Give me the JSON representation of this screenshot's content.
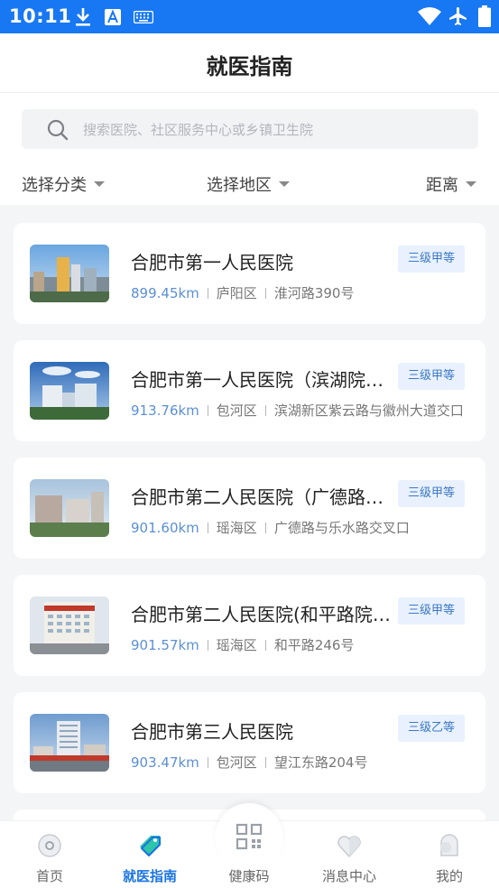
{
  "status_bar": {
    "time": "10:11"
  },
  "header": {
    "title": "就医指南"
  },
  "search": {
    "placeholder": "搜索医院、社区服务中心或乡镇卫生院"
  },
  "filters": {
    "category": "选择分类",
    "region": "选择地区",
    "distance": "距离"
  },
  "hospitals": [
    {
      "name": "合肥市第一人民医院",
      "level": "三级甲等",
      "distance": "899.45km",
      "district": "庐阳区",
      "address": "淮河路390号"
    },
    {
      "name": "合肥市第一人民医院（滨湖院区）",
      "level": "三级甲等",
      "distance": "913.76km",
      "district": "包河区",
      "address": "滨湖新区紫云路与徽州大道交口"
    },
    {
      "name": "合肥市第二人民医院（广德路院区）",
      "level": "三级甲等",
      "distance": "901.60km",
      "district": "瑶海区",
      "address": "广德路与乐水路交叉口"
    },
    {
      "name": "合肥市第二人民医院(和平路院区)",
      "level": "三级甲等",
      "distance": "901.57km",
      "district": "瑶海区",
      "address": "和平路246号"
    },
    {
      "name": "合肥市第三人民医院",
      "level": "三级乙等",
      "distance": "903.47km",
      "district": "包河区",
      "address": "望江东路204号"
    }
  ],
  "tabbar": {
    "home": "首页",
    "guide": "就医指南",
    "health_code": "健康码",
    "messages": "消息中心",
    "mine": "我的"
  },
  "colors": {
    "primary": "#1878f3",
    "badge_bg": "#e8f1fd",
    "distance_text": "#5b8fd6"
  }
}
